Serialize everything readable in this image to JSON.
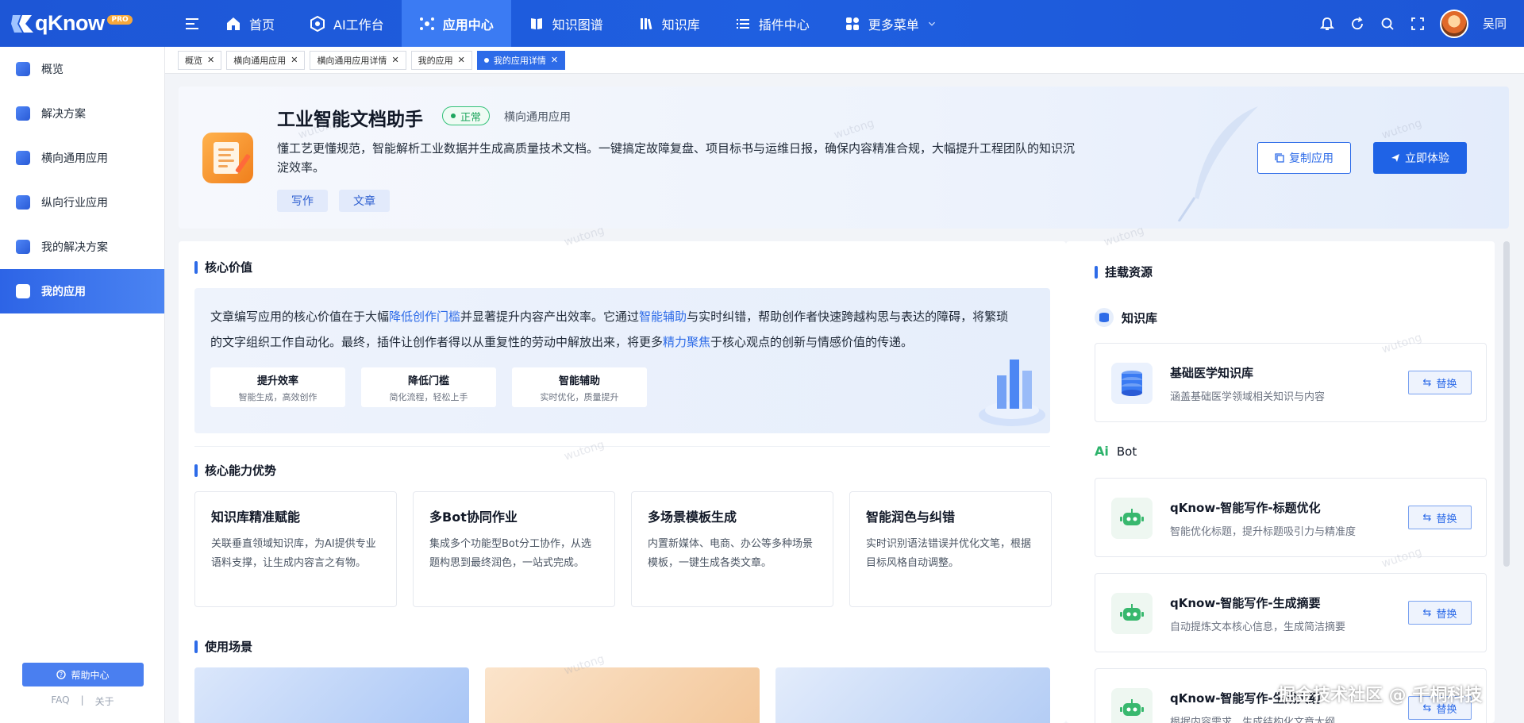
{
  "topbar": {
    "brand": "qKnow",
    "pro": "PRO",
    "nav": [
      {
        "label": "首页"
      },
      {
        "label": "AI工作台"
      },
      {
        "label": "应用中心"
      },
      {
        "label": "知识图谱"
      },
      {
        "label": "知识库"
      },
      {
        "label": "插件中心"
      },
      {
        "label": "更多菜单"
      }
    ],
    "username": "吴同"
  },
  "sidebar": {
    "items": [
      {
        "label": "概览"
      },
      {
        "label": "解决方案"
      },
      {
        "label": "横向通用应用"
      },
      {
        "label": "纵向行业应用"
      },
      {
        "label": "我的解决方案"
      },
      {
        "label": "我的应用"
      }
    ],
    "help": "帮助中心",
    "faq": "FAQ",
    "sep": "|",
    "about": "关于"
  },
  "tabs": [
    {
      "label": "概览"
    },
    {
      "label": "横向通用应用"
    },
    {
      "label": "横向通用应用详情"
    },
    {
      "label": "我的应用"
    },
    {
      "label": "我的应用详情"
    }
  ],
  "hero": {
    "title": "工业智能文档助手",
    "status": "正常",
    "category": "横向通用应用",
    "description": "懂工艺更懂规范，智能解析工业数据并生成高质量技术文档。一键搞定故障复盘、项目标书与运维日报，确保内容精准合规，大幅提升工程团队的知识沉淀效率。",
    "tags": [
      "写作",
      "文章"
    ],
    "copy_button": "复制应用",
    "try_button": "立即体验"
  },
  "core_value": {
    "title": "核心价值",
    "text_parts": [
      "文章编写应用的核心价值在于大幅",
      "降低创作门槛",
      "并显著提升内容产出效率。它通过",
      "智能辅助",
      "与实时纠错，帮助创作者快速跨越构思与表达的障碍，将繁琐的文字组织工作自动化。最终，插件让创作者得以从重复性的劳动中解放出来，将更多",
      "精力聚焦",
      "于核心观点的创新与情感价值的传递。"
    ],
    "cards": [
      {
        "title": "提升效率",
        "sub": "智能生成，高效创作"
      },
      {
        "title": "降低门槛",
        "sub": "简化流程，轻松上手"
      },
      {
        "title": "智能辅助",
        "sub": "实时优化，质量提升"
      }
    ]
  },
  "abilities": {
    "title": "核心能力优势",
    "items": [
      {
        "title": "知识库精准赋能",
        "desc": "关联垂直领域知识库，为AI提供专业语料支撑，让生成内容言之有物。"
      },
      {
        "title": "多Bot协同作业",
        "desc": "集成多个功能型Bot分工协作，从选题构思到最终润色，一站式完成。"
      },
      {
        "title": "多场景模板生成",
        "desc": "内置新媒体、电商、办公等多种场景模板，一键生成各类文章。"
      },
      {
        "title": "智能润色与纠错",
        "desc": "实时识别语法错误并优化文笔，根据目标风格自动调整。"
      }
    ]
  },
  "scenes": {
    "title": "使用场景"
  },
  "resources": {
    "title": "挂载资源",
    "kb_head": "知识库",
    "bot_head": "Bot",
    "bot_prefix": "Ai",
    "replace": "替换",
    "kb": [
      {
        "name": "基础医学知识库",
        "desc": "涵盖基础医学领域相关知识与内容"
      }
    ],
    "bots": [
      {
        "name": "qKnow-智能写作-标题优化",
        "desc": "智能优化标题，提升标题吸引力与精准度"
      },
      {
        "name": "qKnow-智能写作-生成摘要",
        "desc": "自动提炼文本核心信息，生成简洁摘要"
      },
      {
        "name": "qKnow-智能写作-生成大纲",
        "desc": "根据内容需求，生成结构化文章大纲"
      }
    ]
  },
  "watermarks": {
    "text": "wutong",
    "corner": "掘金技术社区 @ 千桐科技"
  },
  "colors": {
    "primary": "#1f63e6",
    "topbar": "#1d56d6",
    "success": "#1ea65e"
  }
}
